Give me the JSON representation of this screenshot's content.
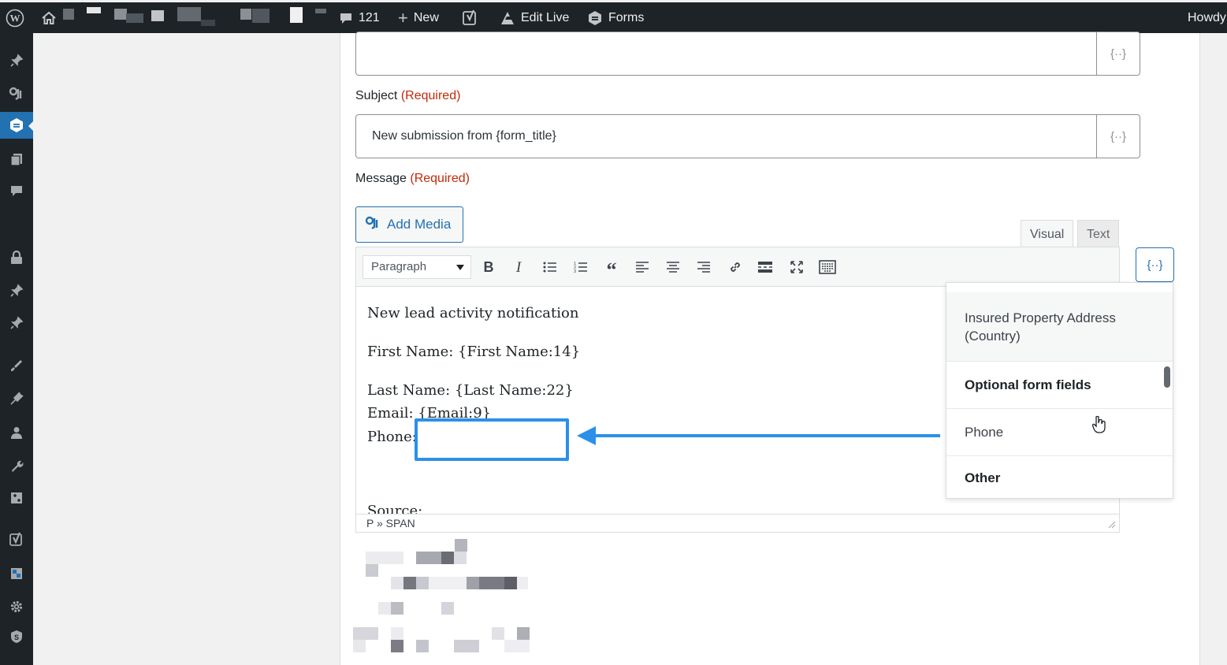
{
  "admin_bar": {
    "comments_count": "121",
    "new_label": "New",
    "edit_live_label": "Edit Live",
    "forms_label": "Forms",
    "howdy_label": "Howdy"
  },
  "form": {
    "subject_label": "Subject",
    "required_text": "(Required)",
    "subject_value": "New submission from {form_title}",
    "message_label": "Message",
    "merge_tag_symbol": "{··}"
  },
  "editor": {
    "add_media_label": "Add Media",
    "tabs": {
      "visual": "Visual",
      "text": "Text"
    },
    "format_select": "Paragraph",
    "lines": [
      "New lead activity notification",
      "First Name: {First Name:14}",
      "Last Name: {Last Name:22}",
      "Email: {Email:9}",
      "Phone:",
      "Source:"
    ],
    "path": "P » SPAN"
  },
  "merge_dropdown": {
    "items": [
      {
        "label": "Insured Property Address (Country)",
        "type": "option"
      },
      {
        "label": "Optional form fields",
        "type": "group"
      },
      {
        "label": "Phone",
        "type": "option"
      },
      {
        "label": "Other",
        "type": "group"
      }
    ]
  },
  "colors": {
    "admin_bar_bg": "#1d2327",
    "accent": "#2271b1",
    "required": "#c02b0a",
    "annotation": "#2b90e9"
  }
}
